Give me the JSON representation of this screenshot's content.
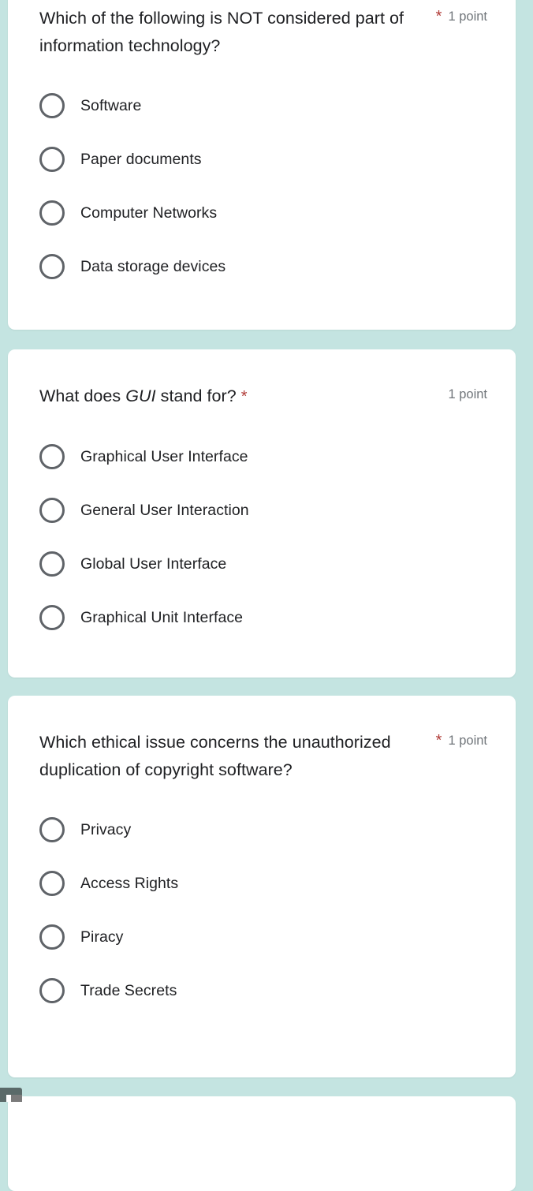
{
  "theme": {
    "background_color": "#c4e4e1",
    "card_color": "#ffffff",
    "required_asterisk_color": "#b03a36",
    "points_text_color": "#70757a",
    "question_text_color": "#202124",
    "radio_border_color": "#5f6368"
  },
  "questions": [
    {
      "id": "q1",
      "title": "Which of the following is NOT considered part of information technology?",
      "required_marker": "*",
      "points": "1 point",
      "asterisk_position": "meta",
      "options": [
        {
          "label": "Software"
        },
        {
          "label": "Paper documents"
        },
        {
          "label": "Computer Networks"
        },
        {
          "label": "Data storage devices"
        }
      ]
    },
    {
      "id": "q2",
      "title_before": "What does ",
      "title_italic": "GUI",
      "title_after": " stand for? ",
      "title": "What does GUI stand for? *",
      "required_marker": "*",
      "points": "1 point",
      "asterisk_position": "inline",
      "options": [
        {
          "label": "Graphical User Interface"
        },
        {
          "label": "General User Interaction"
        },
        {
          "label": "Global User Interface"
        },
        {
          "label": "Graphical Unit Interface"
        }
      ]
    },
    {
      "id": "q3",
      "title": "Which ethical issue concerns the unauthorized duplication of copyright software?",
      "required_marker": "*",
      "points": "1 point",
      "asterisk_position": "meta",
      "options": [
        {
          "label": "Privacy"
        },
        {
          "label": "Access Rights"
        },
        {
          "label": "Piracy"
        },
        {
          "label": "Trade Secrets"
        }
      ]
    }
  ]
}
